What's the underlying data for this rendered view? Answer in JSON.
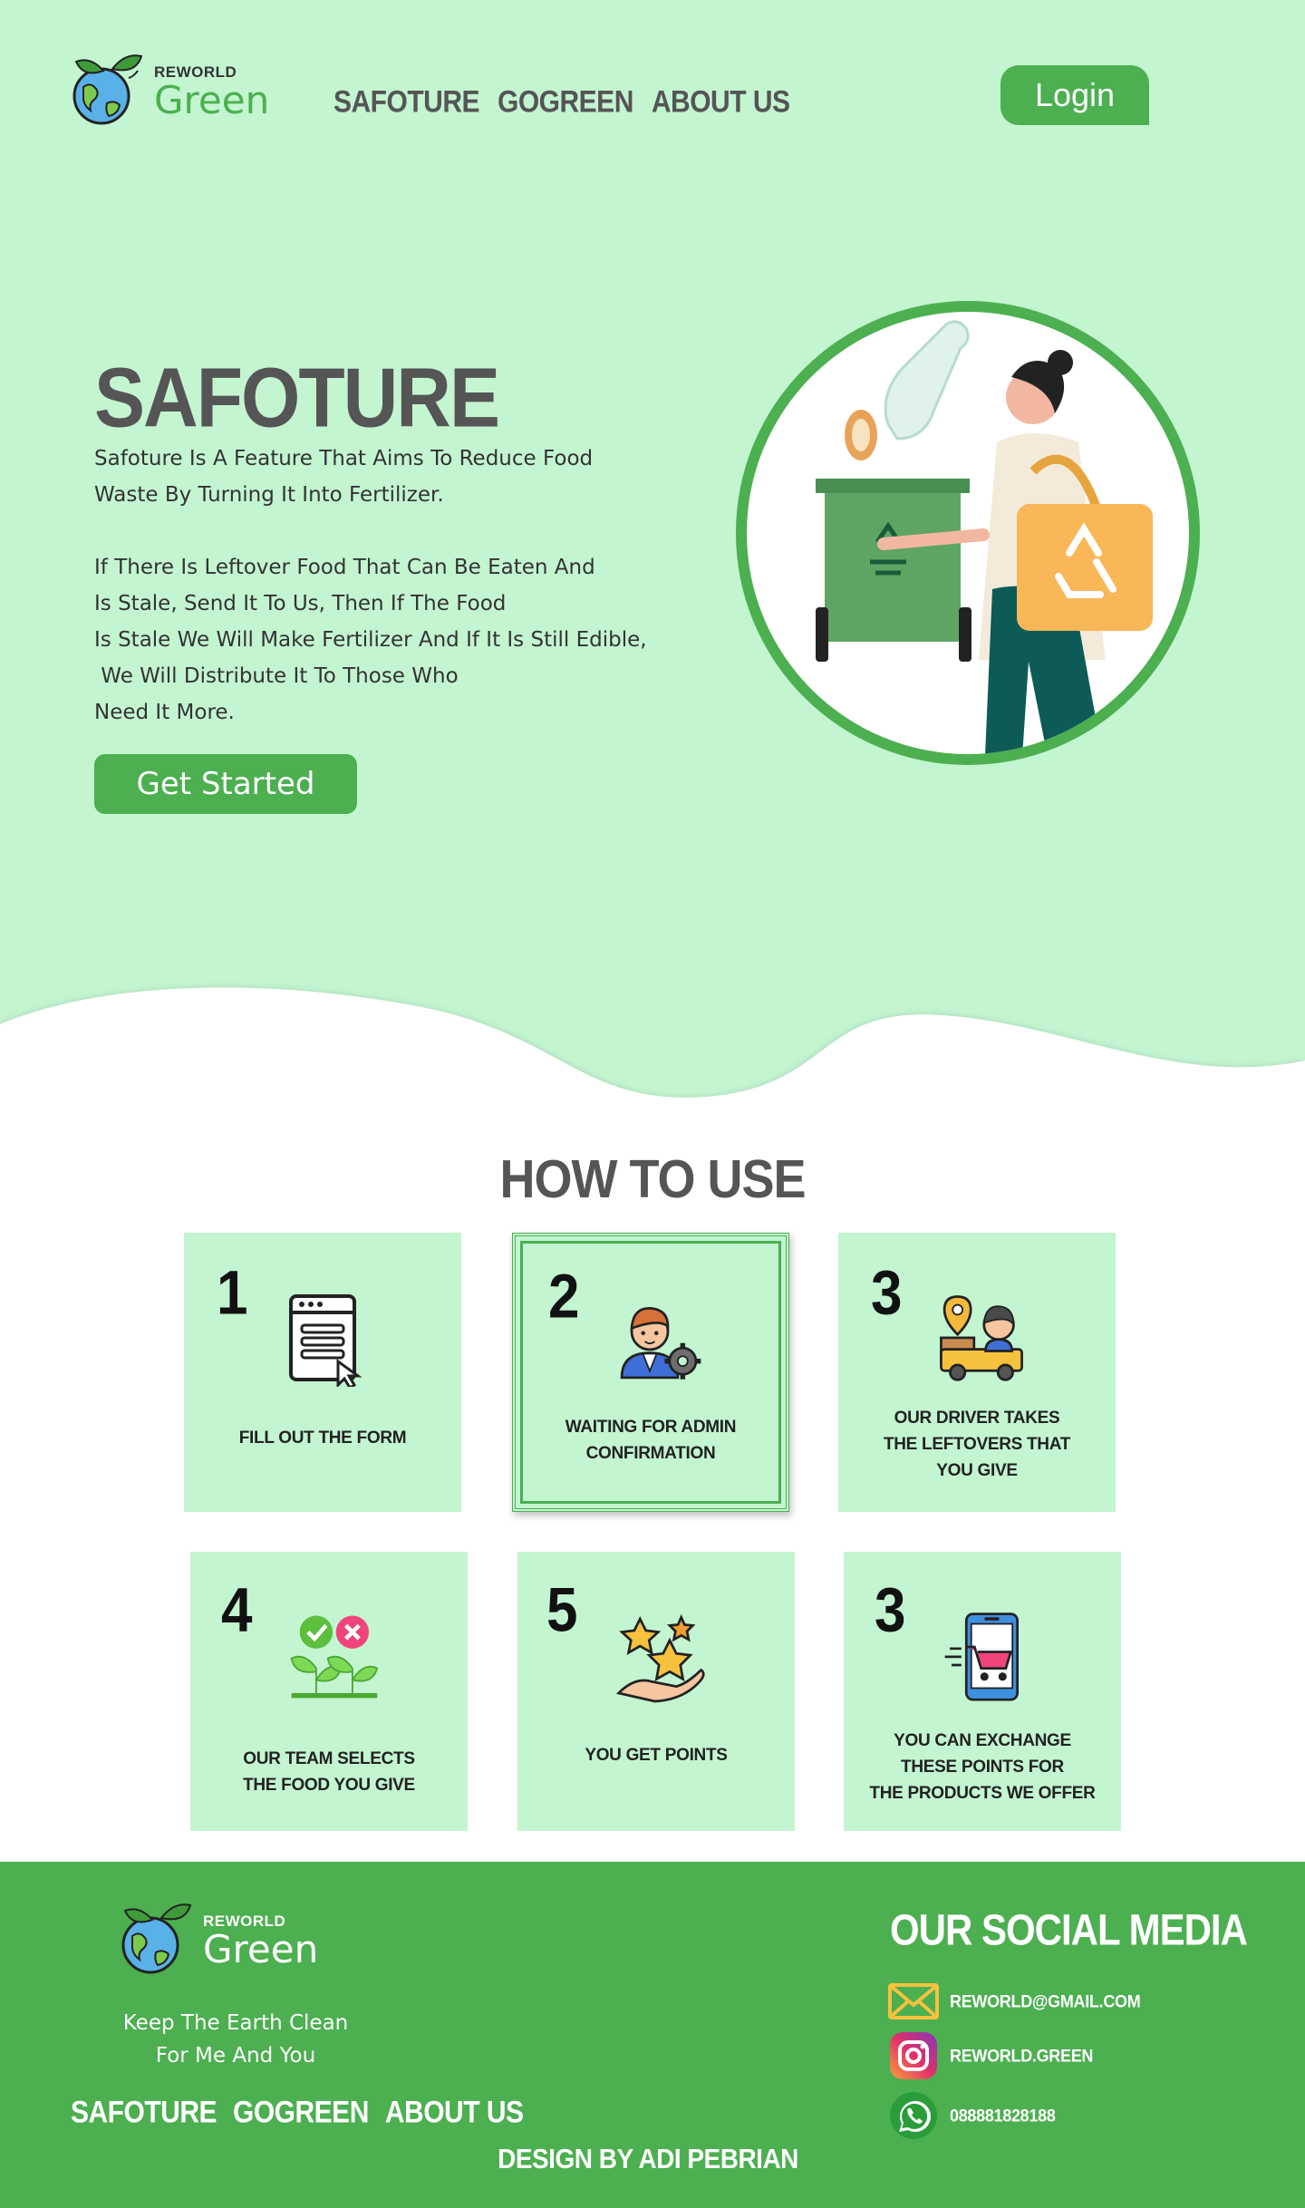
{
  "brand": {
    "small": "REWORLD",
    "big": "Green"
  },
  "nav": [
    {
      "label": "SAFOTURE"
    },
    {
      "label": "GOGREEN"
    },
    {
      "label": "ABOUT US"
    }
  ],
  "login_label": "Login",
  "hero": {
    "title": "SAFOTURE",
    "desc_lines_1": [
      "Safoture Is A Feature That Aims To Reduce Food",
      "Waste By Turning It Into Fertilizer."
    ],
    "desc_lines_2": [
      "If There Is Leftover Food That Can Be Eaten And",
      "Is Stale, Send It To Us, Then If The Food",
      "Is Stale We Will Make Fertilizer And If It Is Still Edible,",
      " We Will Distribute It To Those Who",
      "Need It More."
    ],
    "cta_label": "Get Started"
  },
  "how_to_use": {
    "title": "HOW TO USE",
    "steps": [
      {
        "number": "1",
        "label": "FILL OUT THE FORM",
        "icon": "form-icon"
      },
      {
        "number": "2",
        "label": "WAITING FOR ADMIN\nCONFIRMATION",
        "icon": "admin-icon"
      },
      {
        "number": "3",
        "label": "OUR DRIVER TAKES\nTHE LEFTOVERS THAT\nYOU GIVE",
        "icon": "delivery-icon"
      },
      {
        "number": "4",
        "label": "OUR TEAM SELECTS\nTHE FOOD YOU GIVE",
        "icon": "select-icon"
      },
      {
        "number": "5",
        "label": "YOU GET POINTS",
        "icon": "points-icon"
      },
      {
        "number": "3",
        "label": "YOU CAN EXCHANGE\nTHESE POINTS FOR\nTHE PRODUCTS WE OFFER",
        "icon": "shop-icon"
      }
    ]
  },
  "footer": {
    "tagline": "Keep The Earth Clean\nFor Me And You",
    "social_title": "OUR SOCIAL MEDIA",
    "social": [
      {
        "text": "REWORLD@GMAIL.COM",
        "icon": "mail-icon"
      },
      {
        "text": "REWORLD.GREEN",
        "icon": "instagram-icon"
      },
      {
        "text": "088881828188",
        "icon": "whatsapp-icon"
      }
    ],
    "credit": "DESIGN BY ADI PEBRIAN"
  },
  "colors": {
    "accent": "#4caf50",
    "hero_bg": "#c3f5d1",
    "text": "#555555"
  }
}
